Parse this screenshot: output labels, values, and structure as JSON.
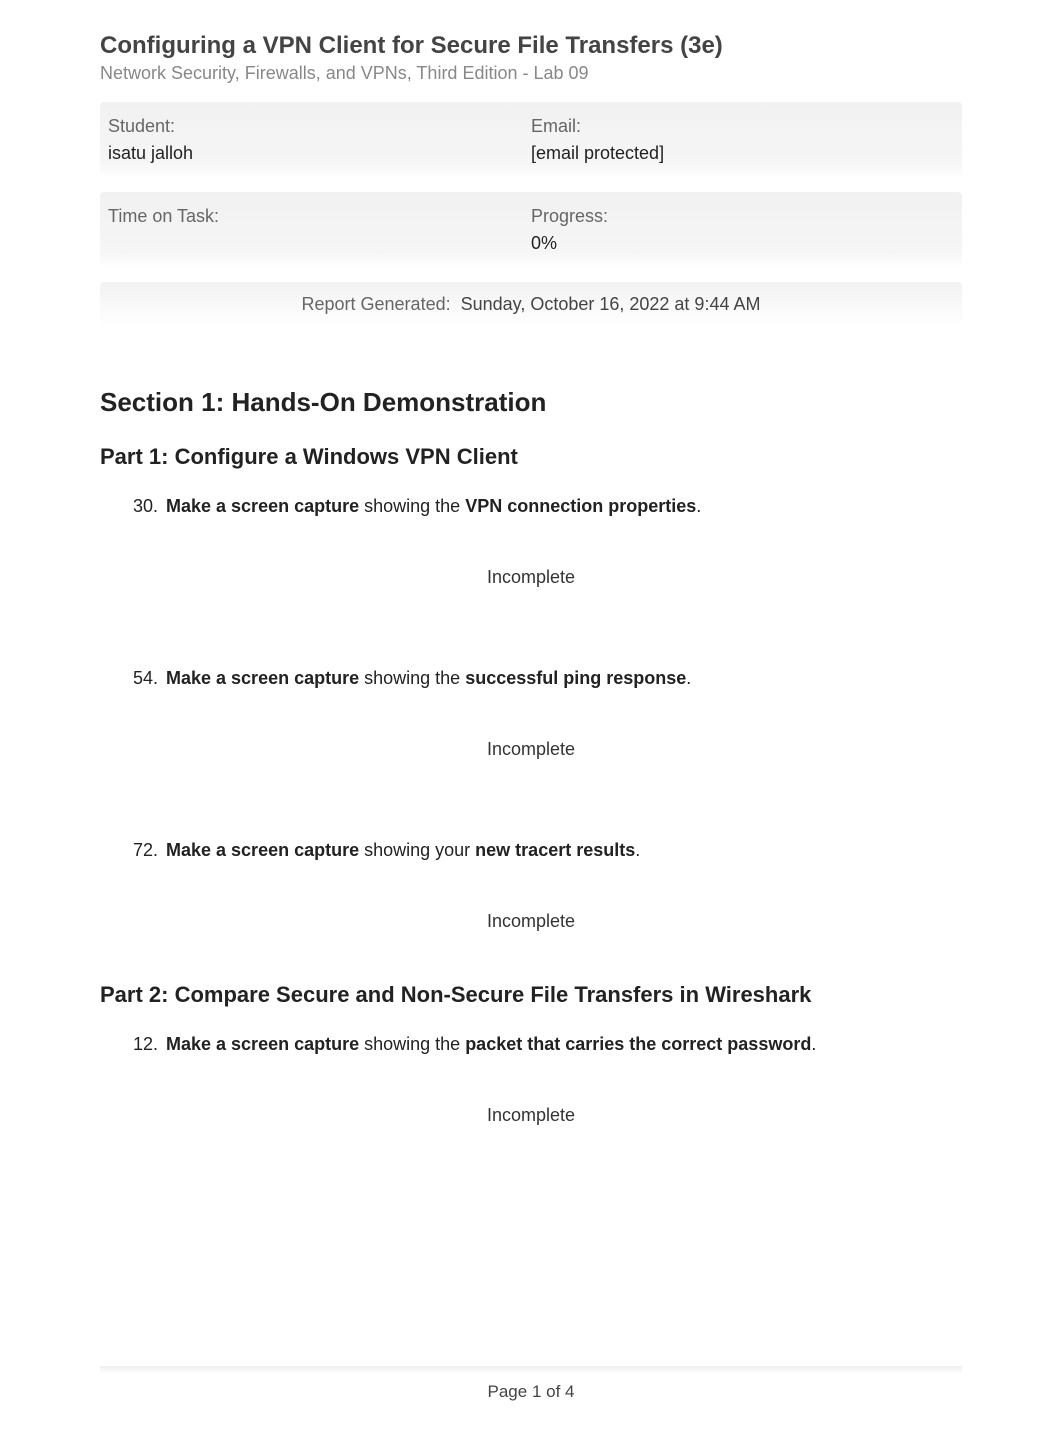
{
  "header": {
    "title": "Configuring a VPN Client for Secure File Transfers (3e)",
    "subtitle": "Network Security, Firewalls, and VPNs, Third Edition - Lab 09"
  },
  "info": {
    "student_label": "Student:",
    "student_value": "isatu jalloh",
    "email_label": "Email:",
    "email_value": "[email protected]",
    "time_label": "Time on Task:",
    "time_value": "",
    "progress_label": "Progress:",
    "progress_value": "0%"
  },
  "report": {
    "label": "Report Generated:",
    "value": "Sunday, October 16, 2022 at 9:44 AM"
  },
  "section1": {
    "heading": "Section 1: Hands-On Demonstration",
    "part1": {
      "heading": "Part 1: Configure a Windows VPN Client",
      "tasks": [
        {
          "num": "30.",
          "bold1": "Make a screen capture",
          "mid": " showing the ",
          "bold2": "VPN connection properties",
          "end": ".",
          "status": "Incomplete"
        },
        {
          "num": "54.",
          "bold1": "Make a screen capture",
          "mid": " showing the ",
          "bold2": "successful ping response",
          "end": ".",
          "status": "Incomplete"
        },
        {
          "num": "72.",
          "bold1": "Make a screen capture",
          "mid": " showing your ",
          "bold2": "new tracert results",
          "end": ".",
          "status": "Incomplete"
        }
      ]
    },
    "part2": {
      "heading": "Part 2: Compare Secure and Non-Secure File Transfers in Wireshark",
      "tasks": [
        {
          "num": "12.",
          "bold1": "Make a screen capture",
          "mid": " showing the ",
          "bold2": "packet that carries the correct password",
          "end": ".",
          "status": "Incomplete"
        }
      ]
    }
  },
  "footer": {
    "page": "Page 1 of 4"
  }
}
